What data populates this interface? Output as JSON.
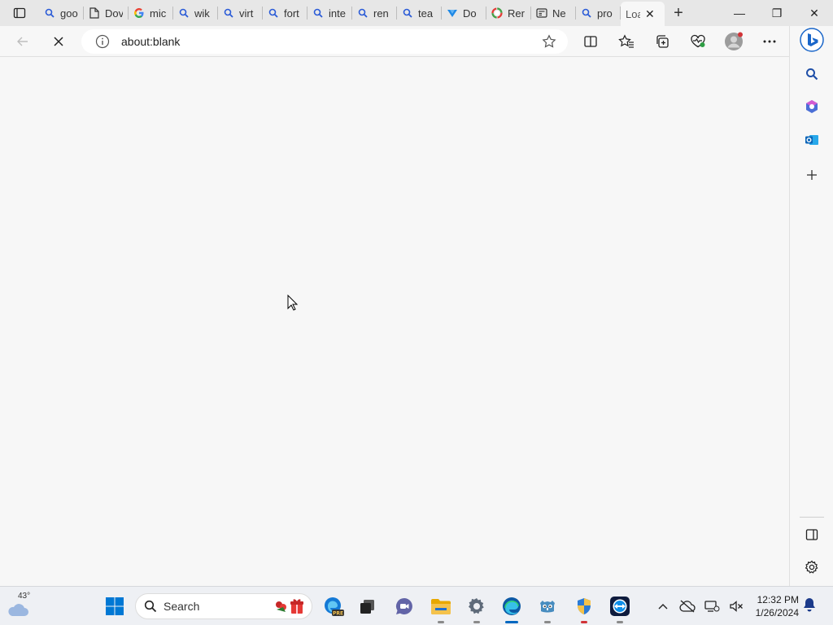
{
  "window": {
    "tabs": [
      {
        "label": "goo",
        "icon": "search-icon"
      },
      {
        "label": "Dov",
        "icon": "document-icon"
      },
      {
        "label": "mic",
        "icon": "google-icon"
      },
      {
        "label": "wik",
        "icon": "search-icon"
      },
      {
        "label": "virt",
        "icon": "search-icon"
      },
      {
        "label": "fort",
        "icon": "search-icon"
      },
      {
        "label": "inte",
        "icon": "search-icon"
      },
      {
        "label": "ren",
        "icon": "search-icon"
      },
      {
        "label": "tea",
        "icon": "search-icon"
      },
      {
        "label": "Do",
        "icon": "download-site-icon"
      },
      {
        "label": "Rer",
        "icon": "colorful-circle-icon"
      },
      {
        "label": "Ne",
        "icon": "news-icon"
      },
      {
        "label": "pro",
        "icon": "search-icon"
      }
    ],
    "active_tab": {
      "label": "Loa",
      "close": "✕"
    },
    "new_tab": "+",
    "controls": {
      "minimize": "—",
      "restore": "❐",
      "close": "✕"
    }
  },
  "toolbar": {
    "url": "about:blank"
  },
  "taskbar": {
    "weather_temp": "43°",
    "search_placeholder": "Search",
    "time": "12:32 PM",
    "date": "1/26/2024"
  },
  "colors": {
    "accent": "#0067c0",
    "edge_blue": "#0c59a4",
    "folder_yellow": "#f4c24c"
  }
}
